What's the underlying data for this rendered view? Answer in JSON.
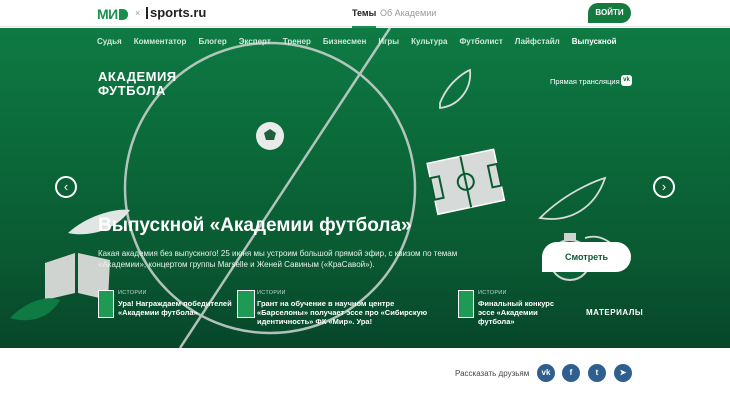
{
  "header": {
    "logo_mir": "МИ",
    "logo_sep": "×",
    "logo_sports": "sports.ru",
    "tabs": [
      {
        "label": "Темы",
        "active": true
      },
      {
        "label": "Об Академии",
        "active": false
      }
    ],
    "login_label": "ВОЙТИ"
  },
  "categories": [
    {
      "label": "Судья",
      "active": false
    },
    {
      "label": "Комментатор",
      "active": false
    },
    {
      "label": "Блогер",
      "active": false
    },
    {
      "label": "Эксперт",
      "active": false
    },
    {
      "label": "Тренер",
      "active": false
    },
    {
      "label": "Бизнесмен",
      "active": false
    },
    {
      "label": "Игры",
      "active": false
    },
    {
      "label": "Культура",
      "active": false
    },
    {
      "label": "Футболист",
      "active": false
    },
    {
      "label": "Лайфстайл",
      "active": false
    },
    {
      "label": "Выпускной",
      "active": true
    }
  ],
  "hero": {
    "logo_line1": "АКАДЕМИЯ",
    "logo_line2": "ФУТБОЛА",
    "live_label": "Прямая трансляция",
    "live_icon": "vk-icon",
    "title": "Выпускной «Академии футбола»",
    "description": "Какая академия без выпускного! 25 июня мы устроим большой прямой эфир, с квизом по темам «Академии», концертом группы Marselle и Женей Савиным («КраСавой»).",
    "watch_label": "Смотреть",
    "prev_icon": "chevron-left-icon",
    "next_icon": "chevron-right-icon"
  },
  "stories": [
    {
      "kicker": "ИСТОРИИ",
      "text": "Ура! Награждаем победителей «Академии футбола»"
    },
    {
      "kicker": "ИСТОРИИ",
      "text": "Грант на обучение в научном центре «Барселоны» получает эссе про «Сибирскую идентичность» ФК «Мир». Ура!"
    },
    {
      "kicker": "ИСТОРИИ",
      "text": "Финальный конкурс эссе «Академии футбола»"
    }
  ],
  "materials_label": "МАТЕРИАЛЫ",
  "share": {
    "label": "Рассказать друзьям",
    "buttons": [
      {
        "name": "vk",
        "text": "vk",
        "color": "#2f5f8f"
      },
      {
        "name": "facebook",
        "text": "f",
        "color": "#2f5f8f"
      },
      {
        "name": "twitter",
        "text": "t",
        "color": "#2f5f8f"
      },
      {
        "name": "telegram",
        "text": "➤",
        "color": "#2f5f8f"
      }
    ]
  },
  "colors": {
    "brand_green": "#1a8f4e",
    "hero_dark": "#0a5a32",
    "share_blue": "#2f5f8f"
  }
}
